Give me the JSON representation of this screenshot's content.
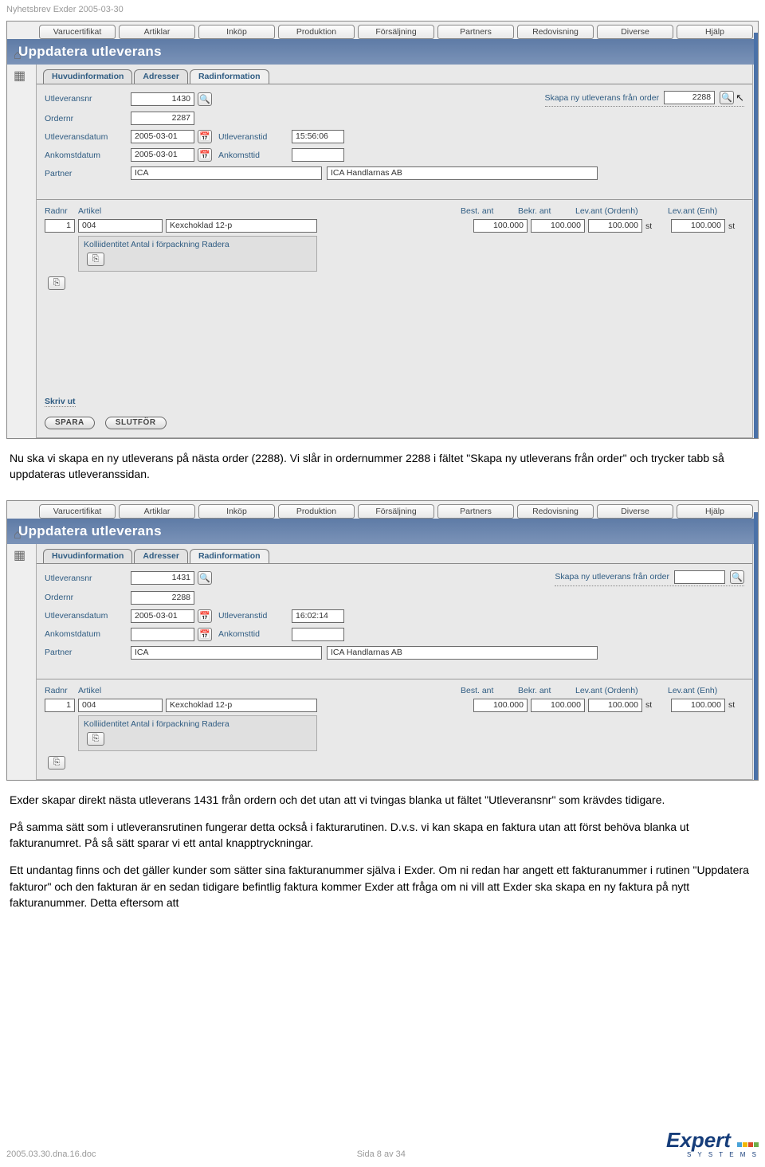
{
  "doc_header": "Nyhetsbrev Exder 2005-03-30",
  "menus": [
    "Varucertifikat",
    "Artiklar",
    "Inköp",
    "Produktion",
    "Försäljning",
    "Partners",
    "Redovisning",
    "Diverse",
    "Hjälp"
  ],
  "page_title": "Uppdatera utleverans",
  "tabs": [
    "Huvudinformation",
    "Adresser",
    "Radinformation"
  ],
  "screenshot1": {
    "fields": {
      "utlevnr_label": "Utleveransnr",
      "utlevnr_value": "1430",
      "ordernr_label": "Ordernr",
      "ordernr_value": "2287",
      "utlevdatum_label": "Utleveransdatum",
      "utlevdatum_value": "2005-03-01",
      "utlevtid_label": "Utleveranstid",
      "utlevtid_value": "15:56:06",
      "ankdatum_label": "Ankomstdatum",
      "ankdatum_value": "2005-03-01",
      "anktid_label": "Ankomsttid",
      "anktid_value": "",
      "partner_label": "Partner",
      "partner_code": "ICA",
      "partner_name": "ICA Handlarnas AB",
      "skapa_label": "Skapa ny utleverans från order",
      "skapa_value": "2288"
    },
    "grid_headers": {
      "radnr": "Radnr",
      "artikel": "Artikel",
      "best": "Best. ant",
      "bekr": "Bekr. ant",
      "levord": "Lev.ant (Ordenh)",
      "levenh": "Lev.ant (Enh)"
    },
    "grid_row": {
      "radnr": "1",
      "artnum": "004",
      "artdesc": "Kexchoklad 12-p",
      "best": "100.000",
      "bekr": "100.000",
      "levord": "100.000",
      "unit1": "st",
      "levenh": "100.000",
      "unit2": "st"
    },
    "sub_header": "Kolliidentitet  Antal i förpackning  Radera",
    "skriv_ut": "Skriv ut",
    "btn_spara": "SPARA",
    "btn_slutfor": "SLUTFÖR"
  },
  "screenshot2": {
    "fields": {
      "utlevnr_value": "1431",
      "ordernr_value": "2288",
      "utlevdatum_value": "2005-03-01",
      "utlevtid_value": "16:02:14",
      "ankdatum_value": "",
      "anktid_value": "",
      "partner_code": "ICA",
      "partner_name": "ICA Handlarnas AB",
      "skapa_value": ""
    },
    "grid_row": {
      "radnr": "1",
      "artnum": "004",
      "artdesc": "Kexchoklad 12-p",
      "best": "100.000",
      "bekr": "100.000",
      "levord": "100.000",
      "unit1": "st",
      "levenh": "100.000",
      "unit2": "st"
    }
  },
  "para1": "Nu ska vi skapa en ny utleverans på nästa order (2288). Vi slår in ordernummer 2288 i fältet \"Skapa ny utleverans från order\" och trycker tabb så uppdateras utleveranssidan.",
  "para2": "Exder skapar direkt nästa utleverans 1431 från ordern och det utan att vi tvingas blanka ut fältet \"Utleveransnr\" som krävdes tidigare.",
  "para3": "På samma sätt som i utleveransrutinen fungerar detta också i fakturarutinen. D.v.s. vi kan skapa en faktura utan att först behöva blanka ut fakturanumret. På så sätt sparar vi ett antal knapptryckningar.",
  "para4": "Ett undantag finns och det gäller kunder som sätter sina fakturanummer själva i Exder. Om ni redan har angett ett fakturanummer i rutinen \"Uppdatera fakturor\" och den fakturan är en sedan tidigare befintlig faktura kommer Exder att fråga om ni vill att Exder ska skapa en ny faktura på nytt fakturanummer. Detta eftersom att",
  "footer_left": "2005.03.30.dna.16.doc",
  "footer_center": "Sida 8 av 34",
  "logo_brand": "Expert",
  "logo_sys": "S Y S T E M S"
}
